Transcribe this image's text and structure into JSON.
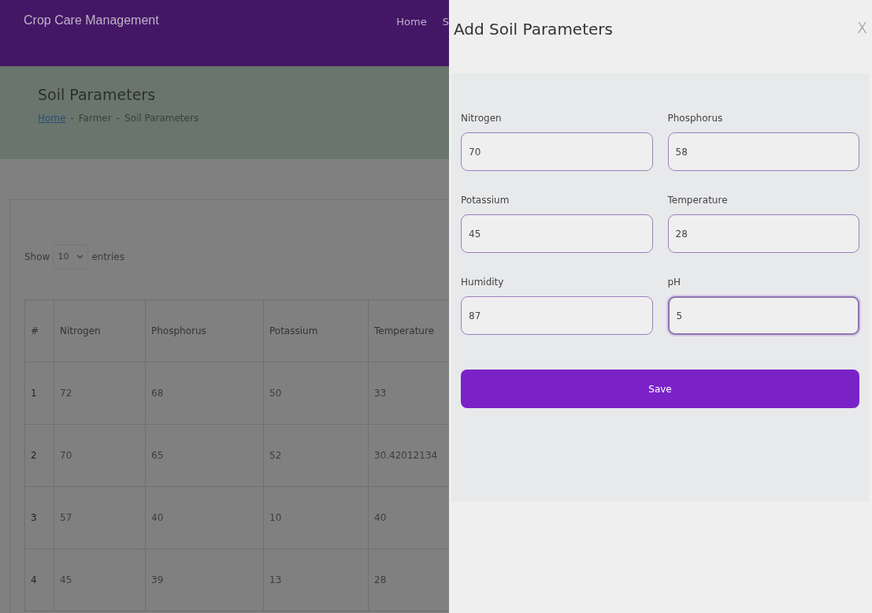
{
  "navbar": {
    "brand": "Crop Care Management",
    "links": [
      "Home",
      "S"
    ]
  },
  "hero": {
    "title": "Soil Parameters",
    "breadcrumb": [
      {
        "label": "Home",
        "kind": "link"
      },
      {
        "label": "-",
        "kind": "separator"
      },
      {
        "label": "Farmer",
        "kind": "text"
      },
      {
        "label": "-",
        "kind": "separator"
      },
      {
        "label": "Soil Parameters",
        "kind": "text"
      }
    ]
  },
  "length_control": {
    "prefix": "Show",
    "value": "10",
    "suffix": "entries"
  },
  "table": {
    "columns": [
      "#",
      "Nitrogen",
      "Phosphorus",
      "Potassium",
      "Temperature"
    ],
    "rows": [
      [
        "1",
        "72",
        "68",
        "50",
        "33"
      ],
      [
        "2",
        "70",
        "65",
        "52",
        "30.42012134"
      ],
      [
        "3",
        "57",
        "40",
        "10",
        "40"
      ],
      [
        "4",
        "45",
        "39",
        "13",
        "28"
      ]
    ]
  },
  "drawer": {
    "title": "Add Soil Parameters",
    "close": "X",
    "fields": [
      {
        "label": "Nitrogen",
        "value": "70",
        "focused": false
      },
      {
        "label": "Phosphorus",
        "value": "58",
        "focused": false
      },
      {
        "label": "Potassium",
        "value": "45",
        "focused": false
      },
      {
        "label": "Temperature",
        "value": "28",
        "focused": false
      },
      {
        "label": "Humidity",
        "value": "87",
        "focused": false
      },
      {
        "label": "pH",
        "value": "5",
        "focused": true
      }
    ],
    "save": "Save"
  }
}
